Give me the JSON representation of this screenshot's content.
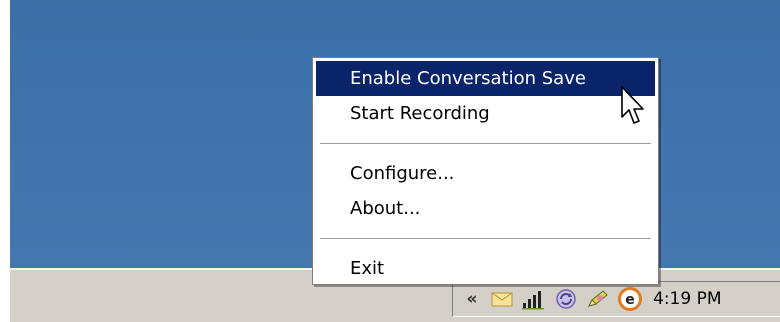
{
  "context_menu": {
    "items": [
      {
        "label": "Enable Conversation Save",
        "highlighted": true
      },
      {
        "label": "Start Recording"
      },
      {
        "label": "Configure..."
      },
      {
        "label": "About..."
      },
      {
        "label": "Exit"
      }
    ]
  },
  "tray": {
    "expand_glyph": "«",
    "icons": [
      "envelope-icon",
      "signal-bars-icon",
      "sync-icon",
      "pencil-icon",
      "e-app-icon"
    ],
    "clock": "4:19 PM"
  },
  "colors": {
    "desktop": "#3a6ea5",
    "menu_highlight": "#0a246a",
    "taskbar": "#d4d0c8",
    "e_icon_orange": "#e07b22"
  }
}
